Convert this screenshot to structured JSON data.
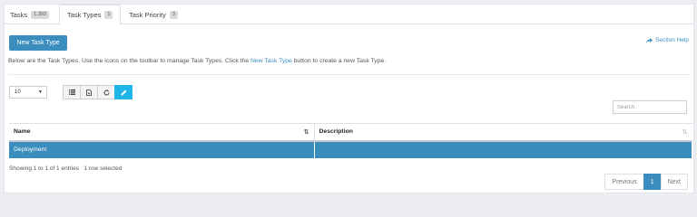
{
  "tabs": [
    {
      "label": "Tasks",
      "badge": "1,303",
      "active": false
    },
    {
      "label": "Task Types",
      "badge": "1",
      "active": true
    },
    {
      "label": "Task Priority",
      "badge": "3",
      "active": false
    }
  ],
  "actions": {
    "new_button": "New Task Type",
    "section_help": "Section Help"
  },
  "info": {
    "before_link": "Below are the Task Types. Use the icons on the toolbar to manage Task Types. Click the ",
    "link": "New Task Type",
    "after_link": " button to create a new Task Type."
  },
  "page_length": {
    "selected": "10"
  },
  "toolbar": {
    "icons": [
      "list-icon",
      "export-icon",
      "refresh-icon",
      "edit-icon"
    ],
    "active_color": "#1fb5e8"
  },
  "search": {
    "placeholder": "Search"
  },
  "table": {
    "columns": [
      "Name",
      "Description"
    ],
    "rows": [
      {
        "name": "Deployment",
        "description": "",
        "selected": true
      }
    ]
  },
  "footer": {
    "showing": "Showing 1 to 1 of 1 entries",
    "selected": "1 row selected"
  },
  "pagination": {
    "previous": "Previous",
    "page": "1",
    "next": "Next"
  },
  "colors": {
    "primary": "#3b8dbd",
    "selected_row": "#3b8dbd",
    "background": "#eceef1"
  }
}
